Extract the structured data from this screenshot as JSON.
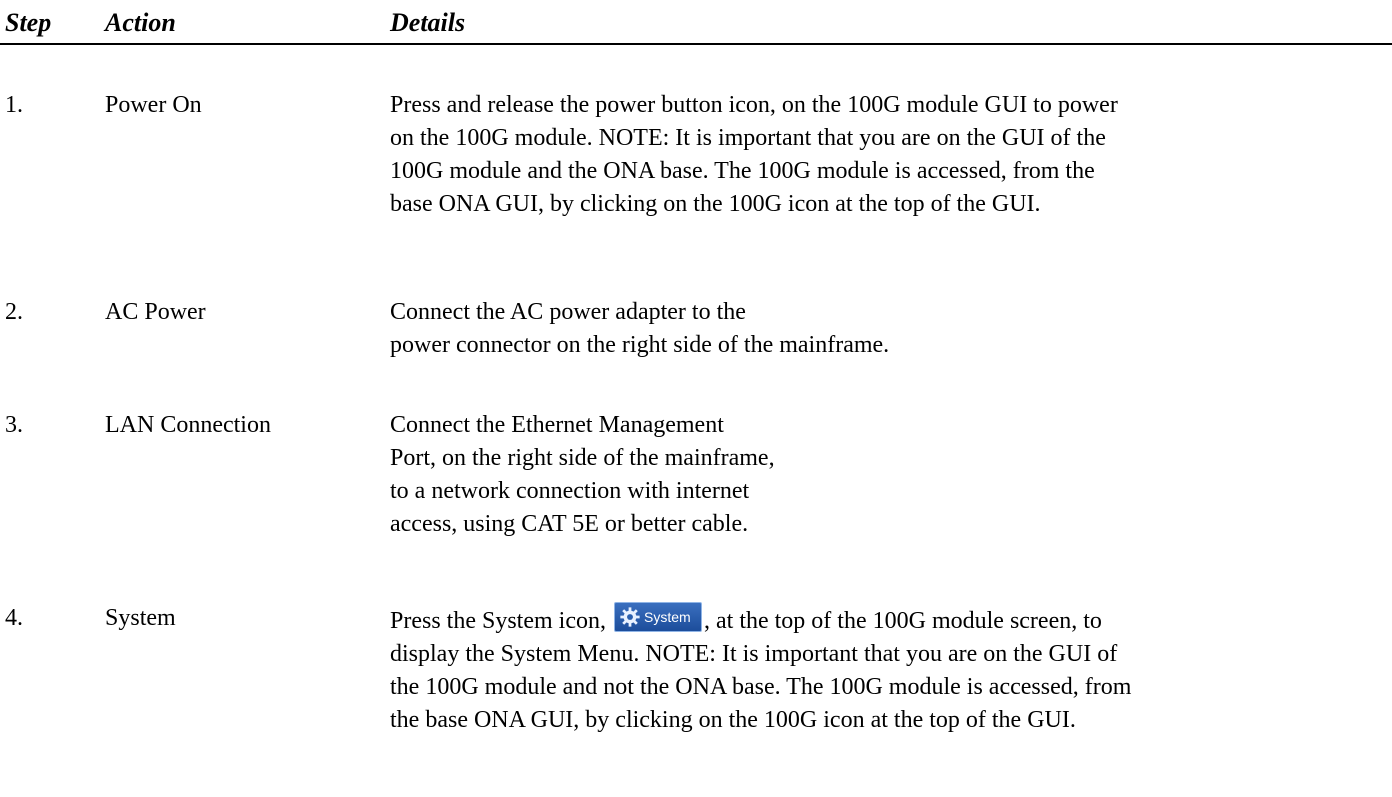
{
  "header": {
    "step": "Step",
    "action": "Action",
    "details": "Details"
  },
  "rows": [
    {
      "num": "1.",
      "action": "Power On",
      "lines": [
        "Press and release the power button icon, on the 100G module GUI to power",
        "on the 100G module. NOTE: It is important that you are on the GUI of the",
        "100G module and the ONA base. The 100G module is accessed, from the",
        "base ONA GUI, by clicking on the 100G icon at the top of the GUI."
      ]
    },
    {
      "num": "2.",
      "action": "AC Power",
      "lines": [
        "Connect the AC power adapter to the",
        "power connector on the right side of the mainframe."
      ]
    },
    {
      "num": "3.",
      "action": "LAN Connection",
      "lines": [
        "Connect the Ethernet Management",
        "Port, on the right side of the mainframe,",
        "to a network connection with internet",
        "access, using CAT 5E or better cable."
      ]
    },
    {
      "num": "4.",
      "action": "System",
      "line1_before": "Press the System icon,",
      "line1_after": ", at the top of the 100G module screen, to",
      "lines": [
        "display the System Menu. NOTE: It is important that you are on the GUI of",
        "the 100G module and not the ONA base. The 100G module is accessed, from",
        "the base ONA GUI, by clicking on the 100G icon at the top of the GUI."
      ],
      "icon": {
        "name": "gear-icon",
        "label": "System",
        "color": "#2a5fae"
      }
    }
  ]
}
